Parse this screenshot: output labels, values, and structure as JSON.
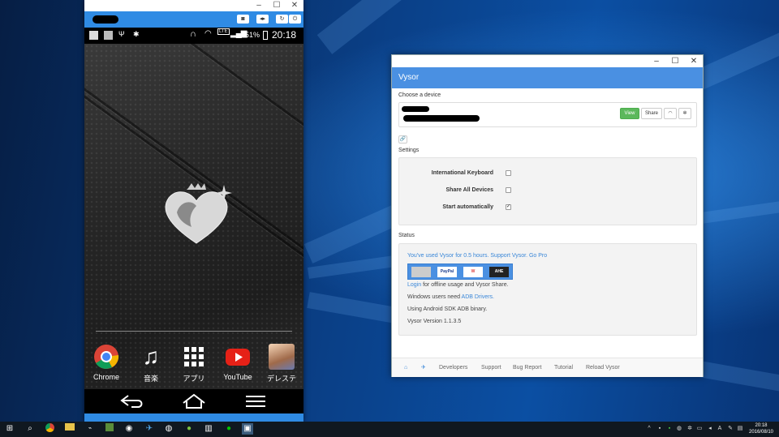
{
  "phone": {
    "titlebar": {
      "min_icon": "minimize-icon",
      "max_icon": "maximize-icon",
      "close_icon": "close-icon"
    },
    "toolbar_buttons": [
      "camera-icon",
      "volume-icon",
      "rotate-icon",
      "power-icon"
    ],
    "statusbar": {
      "battery": "51%",
      "time": "20:18",
      "network": "LTE"
    },
    "dock": [
      {
        "label": "Chrome",
        "icon": "chrome-icon"
      },
      {
        "label": "音楽",
        "icon": "music-icon"
      },
      {
        "label": "アプリ",
        "icon": "app-grid-icon"
      },
      {
        "label": "YouTube",
        "icon": "youtube-icon"
      },
      {
        "label": "デレステ",
        "icon": "game-icon"
      }
    ],
    "nav": [
      "back-icon",
      "home-icon",
      "menu-icon"
    ]
  },
  "vysor": {
    "title": "Vysor",
    "choose_device_label": "Choose a device",
    "device_buttons": {
      "view": "View",
      "share": "Share"
    },
    "settings_label": "Settings",
    "settings": [
      {
        "label": "International Keyboard",
        "checked": false
      },
      {
        "label": "Share All Devices",
        "checked": false
      },
      {
        "label": "Start automatically",
        "checked": true
      }
    ],
    "status_label": "Status",
    "status": {
      "usage": "You've used Vysor for 0.5 hours. Support Vysor. Go Pro",
      "login_link": "Login",
      "login_rest": " for offline usage and Vysor Share.",
      "windows_prefix": "Windows users need ",
      "windows_link": "ADB Drivers.",
      "adb": "Using Android SDK ADB binary.",
      "version": "Vysor Version 1.1.3.5"
    },
    "payment_tiles": [
      "card",
      "PayPal",
      "wallet",
      "AHE"
    ],
    "footer": [
      "Developers",
      "Support",
      "Bug Report",
      "Tutorial",
      "Reload Vysor"
    ]
  },
  "taskbar": {
    "clock_time": "20:18",
    "clock_date": "2016/08/10"
  }
}
